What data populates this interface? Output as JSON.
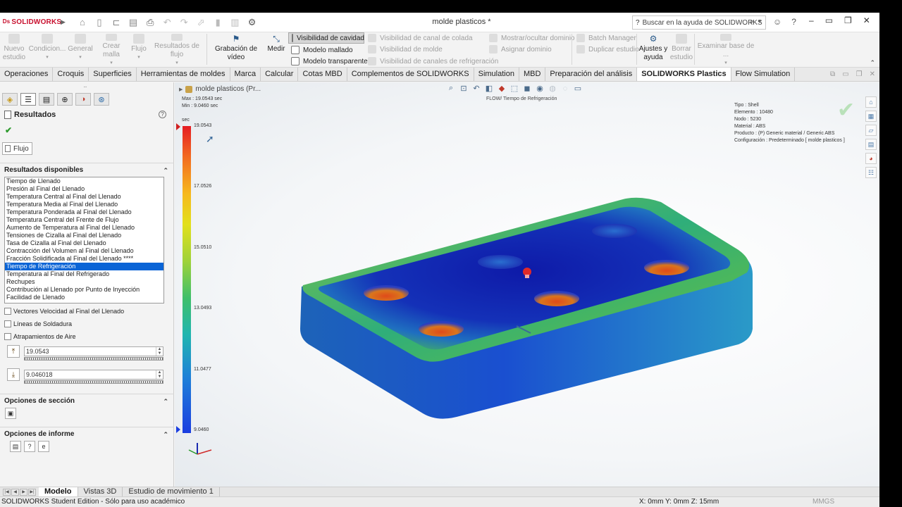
{
  "app": {
    "logo": "SOLIDWORKS",
    "document_title": "molde plasticos *"
  },
  "search": {
    "placeholder": "Buscar en la ayuda de SOLIDWORKS"
  },
  "ribbon": {
    "nuevo_estudio": "Nuevo\nestudio",
    "condiciones": "Condicion...",
    "general": "General",
    "crear_malla": "Crear malla",
    "flujo": "Flujo",
    "resultados_flujo": "Resultados de flujo",
    "grabacion_video": "Grabación de vídeo",
    "medir": "Medir",
    "visibilidad_cavidad": "Visibilidad de cavidad",
    "modelo_mallado": "Modelo mallado",
    "modelo_transparente": "Modelo transparente",
    "visibilidad_canal": "Visibilidad de canal de colada",
    "visibilidad_molde": "Visibilidad de molde",
    "visibilidad_refrigeracion": "Visibilidad de canales de refrigeración",
    "mostrar_ocultar": "Mostrar/ocultar dominio",
    "asignar_dominio": "Asignar dominio",
    "batch_manager": "Batch Manager",
    "duplicar_estudio": "Duplicar estudio",
    "ajustes_ayuda": "Ajustes y\nayuda",
    "borrar_estudio": "Borrar\nestudio",
    "examinar_base": "Examinar base de ..."
  },
  "tabs": [
    "Operaciones",
    "Croquis",
    "Superficies",
    "Herramientas de moldes",
    "Marca",
    "Calcular",
    "Cotas MBD",
    "Complementos de SOLIDWORKS",
    "Simulation",
    "MBD",
    "Preparación del análisis",
    "SOLIDWORKS Plastics",
    "Flow Simulation"
  ],
  "active_tab": "SOLIDWORKS Plastics",
  "panel": {
    "title": "Resultados",
    "flujo_label": "Flujo",
    "section_available": "Resultados disponibles",
    "results": [
      "Tiempo de Llenado",
      "Presión al Final del Llenado",
      "Temperatura Central al Final del Llenado",
      "Temperatura Media al Final del Llenado",
      "Temperatura Ponderada al Final del Llenado",
      "Temperatura Central del Frente de Flujo",
      "Aumento de Temperatura al Final del Llenado",
      "Tensiones de Cizalla al Final del Llenado",
      "Tasa de Cizalla al Final del Llenado",
      "Contracción del Volumen al Final del Llenado",
      "Fracción Solidificada al Final del Llenado ****",
      "Tiempo de Refrigeración",
      "Temperatura al Final del Refrigerado",
      "Rechupes",
      "Contribución al Llenado por Punto de Inyección",
      "Facilidad de Llenado"
    ],
    "selected_result": "Tiempo de Refrigeración",
    "chk_velocidad": "Vectores Velocidad al Final del Llenado",
    "chk_soldadura": "Líneas de Soldadura",
    "chk_aire": "Atrapamientos de Aire",
    "max_value": "19.0543",
    "min_value": "9.046018",
    "section_seccion": "Opciones de sección",
    "section_informe": "Opciones de informe"
  },
  "viewport": {
    "tree_item": "molde plasticos  (Pr...",
    "max_text": "Max : 19.0543 sec",
    "min_text": "Min : 9.0460 sec",
    "plot_title": "FLOW/ Tiempo de Refrigeración",
    "info": {
      "tipo": "Tipo : Shell",
      "elemento": "Elemento : 10480",
      "nodo": "Nodo : 5230",
      "material": "Material : ABS",
      "producto": "Producto : (P)  Generic material / Generic ABS",
      "configuracion": "Configuración : Predeterminado [ molde plasticos ]"
    },
    "legend": {
      "unit": "sec",
      "labels": [
        "19.0543",
        "17.0526",
        "15.0510",
        "13.0493",
        "11.0477",
        "9.0460"
      ]
    }
  },
  "bottom_tabs": [
    "Modelo",
    "Vistas 3D",
    "Estudio de movimiento 1"
  ],
  "active_bottom_tab": "Modelo",
  "status": {
    "left": "SOLIDWORKS Student Edition - Sólo para uso académico",
    "coords": "X: 0mm Y: 0mm Z: 15mm",
    "units": "MMGS"
  },
  "colors": {
    "accent": "#c8102e",
    "selection": "#0a64d6",
    "check": "#2d9a2d"
  }
}
